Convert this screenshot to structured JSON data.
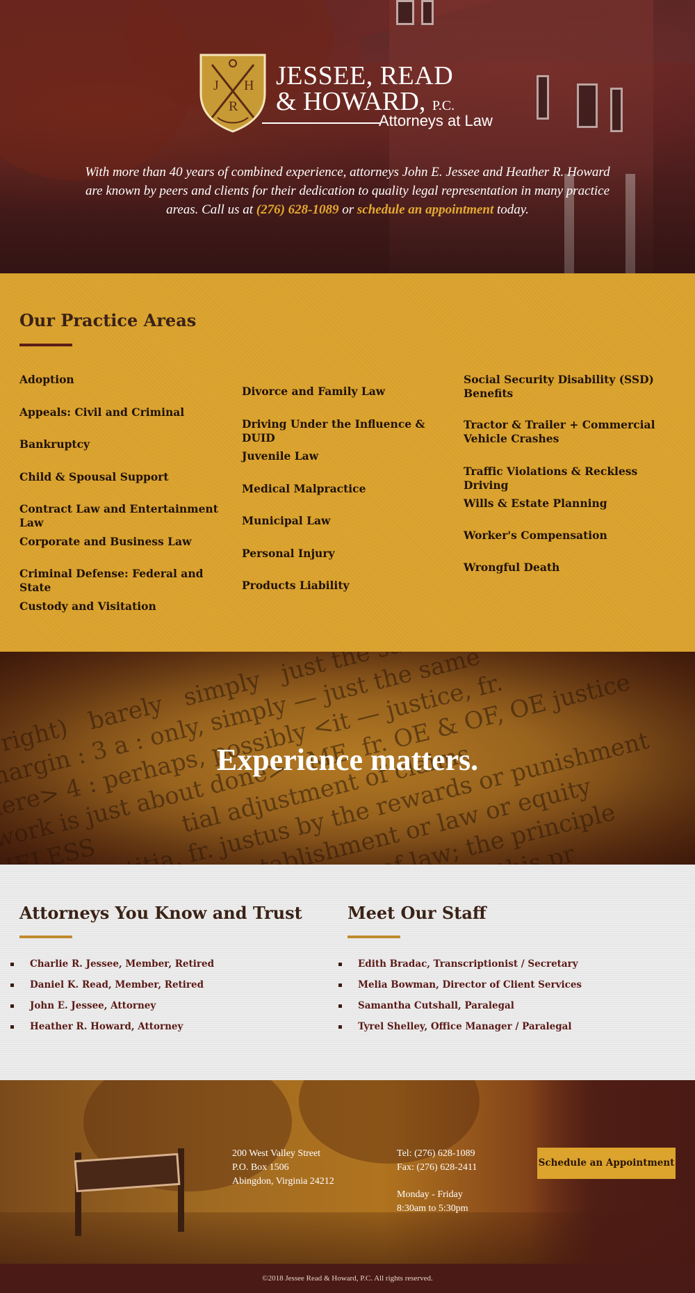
{
  "hero": {
    "logo": {
      "monogram": [
        "J",
        "H",
        "R"
      ],
      "line1": "JESSEE, READ",
      "line2": "& HOWARD,",
      "pc": "P.C.",
      "tagline": "Attorneys at Law"
    },
    "intro_before": "With more than 40 years of combined experience, attorneys John E. Jessee and Heather R. Howard are known by peers and clients for their dedication to quality legal representation in many practice areas. Call us at ",
    "phone_link": "(276) 628-1089",
    "intro_middle": " or ",
    "appointment_link": "schedule an appointment",
    "intro_after": " today."
  },
  "practice": {
    "title": "Our Practice Areas",
    "column1": [
      "Adoption",
      "Appeals: Civil and Criminal",
      "Bankruptcy",
      "Child & Spousal Support",
      "Contract Law and Entertainment Law",
      "Corporate and Business Law",
      "Criminal Defense: Federal and State",
      "Custody and Visitation"
    ],
    "column2": [
      "Divorce and Family Law",
      "Driving Under the Influence & DUID",
      "Juvenile Law",
      "Medical Malpractice",
      "Municipal Law",
      "Personal Injury",
      "Products Liability"
    ],
    "column3": [
      "Social Security Disability (SSD) Benefits",
      "Tractor & Trailer + Commercial Vehicle Crashes",
      "Traffic Violations & Reckless Driving",
      "Wills & Estate Planning",
      "Worker's Compensation",
      "Wrongful Death"
    ]
  },
  "banner": {
    "headline": "Experience matters."
  },
  "attorneys": {
    "title": "Attorneys You Know and Trust",
    "items": [
      "Charlie R. Jessee, Member, Retired",
      "Daniel K. Read, Member, Retired",
      "John E. Jessee, Attorney",
      "Heather R. Howard, Attorney"
    ]
  },
  "staff": {
    "title": "Meet Our Staff",
    "items": [
      "Edith Bradac, Transcriptionist / Secretary",
      "Melia Bowman, Director of Client Services",
      "Samantha Cutshall, Paralegal",
      "Tyrel Shelley, Office Manager / Paralegal"
    ]
  },
  "footer": {
    "address": [
      "200 West Valley Street",
      "P.O. Box 1506",
      "Abingdon, Virginia 24212"
    ],
    "contact": [
      "Tel: (276) 628-1089",
      "Fax: (276) 628-2411"
    ],
    "hours": [
      "Monday - Friday",
      "8:30am to 5:30pm"
    ],
    "cta_label": "Schedule an Appointment",
    "copyright": "©2018 Jessee Read & Howard, P.C. All rights reserved."
  },
  "colors": {
    "gold": "#dca32d",
    "maroon": "#5b1e16",
    "link_gold": "#e5aa30"
  }
}
